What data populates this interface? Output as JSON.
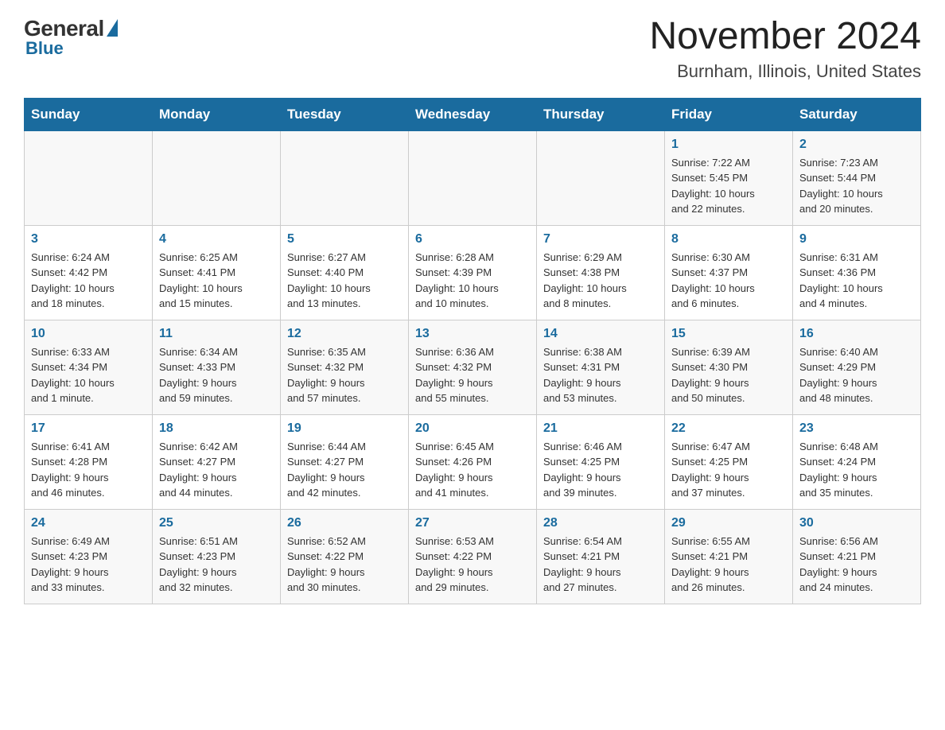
{
  "logo": {
    "general": "General",
    "blue": "Blue"
  },
  "title": "November 2024",
  "subtitle": "Burnham, Illinois, United States",
  "days_of_week": [
    "Sunday",
    "Monday",
    "Tuesday",
    "Wednesday",
    "Thursday",
    "Friday",
    "Saturday"
  ],
  "weeks": [
    [
      {
        "day": "",
        "info": ""
      },
      {
        "day": "",
        "info": ""
      },
      {
        "day": "",
        "info": ""
      },
      {
        "day": "",
        "info": ""
      },
      {
        "day": "",
        "info": ""
      },
      {
        "day": "1",
        "info": "Sunrise: 7:22 AM\nSunset: 5:45 PM\nDaylight: 10 hours\nand 22 minutes."
      },
      {
        "day": "2",
        "info": "Sunrise: 7:23 AM\nSunset: 5:44 PM\nDaylight: 10 hours\nand 20 minutes."
      }
    ],
    [
      {
        "day": "3",
        "info": "Sunrise: 6:24 AM\nSunset: 4:42 PM\nDaylight: 10 hours\nand 18 minutes."
      },
      {
        "day": "4",
        "info": "Sunrise: 6:25 AM\nSunset: 4:41 PM\nDaylight: 10 hours\nand 15 minutes."
      },
      {
        "day": "5",
        "info": "Sunrise: 6:27 AM\nSunset: 4:40 PM\nDaylight: 10 hours\nand 13 minutes."
      },
      {
        "day": "6",
        "info": "Sunrise: 6:28 AM\nSunset: 4:39 PM\nDaylight: 10 hours\nand 10 minutes."
      },
      {
        "day": "7",
        "info": "Sunrise: 6:29 AM\nSunset: 4:38 PM\nDaylight: 10 hours\nand 8 minutes."
      },
      {
        "day": "8",
        "info": "Sunrise: 6:30 AM\nSunset: 4:37 PM\nDaylight: 10 hours\nand 6 minutes."
      },
      {
        "day": "9",
        "info": "Sunrise: 6:31 AM\nSunset: 4:36 PM\nDaylight: 10 hours\nand 4 minutes."
      }
    ],
    [
      {
        "day": "10",
        "info": "Sunrise: 6:33 AM\nSunset: 4:34 PM\nDaylight: 10 hours\nand 1 minute."
      },
      {
        "day": "11",
        "info": "Sunrise: 6:34 AM\nSunset: 4:33 PM\nDaylight: 9 hours\nand 59 minutes."
      },
      {
        "day": "12",
        "info": "Sunrise: 6:35 AM\nSunset: 4:32 PM\nDaylight: 9 hours\nand 57 minutes."
      },
      {
        "day": "13",
        "info": "Sunrise: 6:36 AM\nSunset: 4:32 PM\nDaylight: 9 hours\nand 55 minutes."
      },
      {
        "day": "14",
        "info": "Sunrise: 6:38 AM\nSunset: 4:31 PM\nDaylight: 9 hours\nand 53 minutes."
      },
      {
        "day": "15",
        "info": "Sunrise: 6:39 AM\nSunset: 4:30 PM\nDaylight: 9 hours\nand 50 minutes."
      },
      {
        "day": "16",
        "info": "Sunrise: 6:40 AM\nSunset: 4:29 PM\nDaylight: 9 hours\nand 48 minutes."
      }
    ],
    [
      {
        "day": "17",
        "info": "Sunrise: 6:41 AM\nSunset: 4:28 PM\nDaylight: 9 hours\nand 46 minutes."
      },
      {
        "day": "18",
        "info": "Sunrise: 6:42 AM\nSunset: 4:27 PM\nDaylight: 9 hours\nand 44 minutes."
      },
      {
        "day": "19",
        "info": "Sunrise: 6:44 AM\nSunset: 4:27 PM\nDaylight: 9 hours\nand 42 minutes."
      },
      {
        "day": "20",
        "info": "Sunrise: 6:45 AM\nSunset: 4:26 PM\nDaylight: 9 hours\nand 41 minutes."
      },
      {
        "day": "21",
        "info": "Sunrise: 6:46 AM\nSunset: 4:25 PM\nDaylight: 9 hours\nand 39 minutes."
      },
      {
        "day": "22",
        "info": "Sunrise: 6:47 AM\nSunset: 4:25 PM\nDaylight: 9 hours\nand 37 minutes."
      },
      {
        "day": "23",
        "info": "Sunrise: 6:48 AM\nSunset: 4:24 PM\nDaylight: 9 hours\nand 35 minutes."
      }
    ],
    [
      {
        "day": "24",
        "info": "Sunrise: 6:49 AM\nSunset: 4:23 PM\nDaylight: 9 hours\nand 33 minutes."
      },
      {
        "day": "25",
        "info": "Sunrise: 6:51 AM\nSunset: 4:23 PM\nDaylight: 9 hours\nand 32 minutes."
      },
      {
        "day": "26",
        "info": "Sunrise: 6:52 AM\nSunset: 4:22 PM\nDaylight: 9 hours\nand 30 minutes."
      },
      {
        "day": "27",
        "info": "Sunrise: 6:53 AM\nSunset: 4:22 PM\nDaylight: 9 hours\nand 29 minutes."
      },
      {
        "day": "28",
        "info": "Sunrise: 6:54 AM\nSunset: 4:21 PM\nDaylight: 9 hours\nand 27 minutes."
      },
      {
        "day": "29",
        "info": "Sunrise: 6:55 AM\nSunset: 4:21 PM\nDaylight: 9 hours\nand 26 minutes."
      },
      {
        "day": "30",
        "info": "Sunrise: 6:56 AM\nSunset: 4:21 PM\nDaylight: 9 hours\nand 24 minutes."
      }
    ]
  ]
}
